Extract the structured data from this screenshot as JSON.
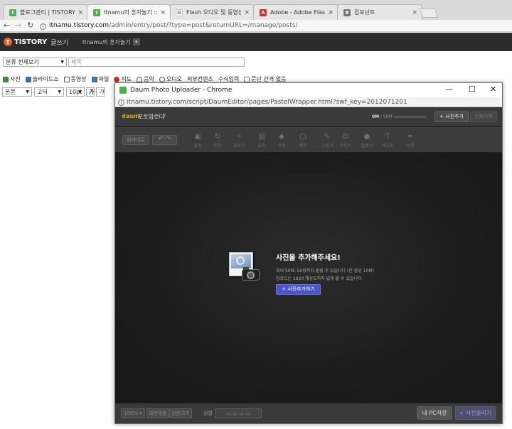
{
  "browser": {
    "tabs": [
      {
        "label": "블로그관리 | TISTORY",
        "close": "×",
        "fav_color": "#4caf50"
      },
      {
        "label": "Itnamu의 혼자놀기 :: 글",
        "close": "×",
        "fav_color": "#4caf50"
      },
      {
        "label": "Flash 오디오 및 동영상",
        "close": "×",
        "fav_color": "#4285f4"
      },
      {
        "label": "Adobe - Adobe Flash Pl",
        "close": "×",
        "fav_color": "#d32f2f"
      },
      {
        "label": "컴포넌트",
        "close": "×",
        "fav_color": "#777777"
      }
    ],
    "url_host": "itnamu.tistory.com",
    "url_path": "/admin/entry/post/?type=post&returnURL=/manage/posts/"
  },
  "tistory": {
    "logo_letter": "T",
    "logo": "TISTORY",
    "write": "글쓰기",
    "blog_name": "Itnamu의 혼자놀기",
    "blog_drop": "▾"
  },
  "editor": {
    "category": "분류 전체보기",
    "title_placeholder": "제목",
    "attach_items": [
      {
        "label": "사진",
        "icon": "photo-icon",
        "color": "#3b8a3b"
      },
      {
        "label": "슬라이드쇼",
        "icon": "slideshow-icon",
        "color": "#3a6fb0"
      },
      {
        "label": "동영상",
        "icon": "video-icon",
        "color": "#555555"
      },
      {
        "label": "파일",
        "icon": "file-icon",
        "color": "#3a6fb0"
      },
      {
        "label": "지도",
        "icon": "map-icon",
        "color": "#c0392b"
      },
      {
        "label": "음악",
        "icon": "music-icon",
        "color": "#555555"
      },
      {
        "label": "오디오",
        "icon": "audio-icon",
        "color": "#555555"
      },
      {
        "label": "외부컨텐츠",
        "icon": "",
        "color": ""
      },
      {
        "label": "수식입력",
        "icon": "",
        "color": ""
      },
      {
        "label": "문단 간격 없음",
        "icon": "checkbox-icon",
        "color": "#888888"
      }
    ],
    "format": {
      "block": "본문",
      "font": "고딕",
      "size": "10pt",
      "bold": "가",
      "italic": "가"
    }
  },
  "popup": {
    "title": "Daum Photo Uploader - Chrome",
    "url": "itnamu.tistory.com/script/DaumEditor/pages/PastelWrapper.html?swf_key=2012071201",
    "daum": "daum",
    "uploader_name": "포토업로더",
    "help": "?",
    "usage": "0M",
    "usage_max": "/ 50M",
    "add_photo": "사진추가",
    "delete_all": "전체삭제",
    "undo_redo_label": "원래대로",
    "tools": [
      "잘라",
      "회전",
      "자르기",
      "효과",
      "수정",
      "액자",
      "그리기",
      "스티커",
      "말풍선",
      "텍스트",
      "서명"
    ],
    "empty_title": "사진을 추가해주세요!",
    "empty_line1": "최대 50M, 50장까지 올릴 수 있습니다 (한 장당 10M)",
    "empty_line2": "업로드는 1920 해상도까지 넓게 할 수 있습니다",
    "empty_button": "사진추가하기",
    "zoom": "100%",
    "view_btn1": "외면맞춤",
    "view_btn2": "원본크기",
    "sort_label": "정렬",
    "my_pc_save": "내 PC저장",
    "upload_btn": "사진올리기"
  }
}
